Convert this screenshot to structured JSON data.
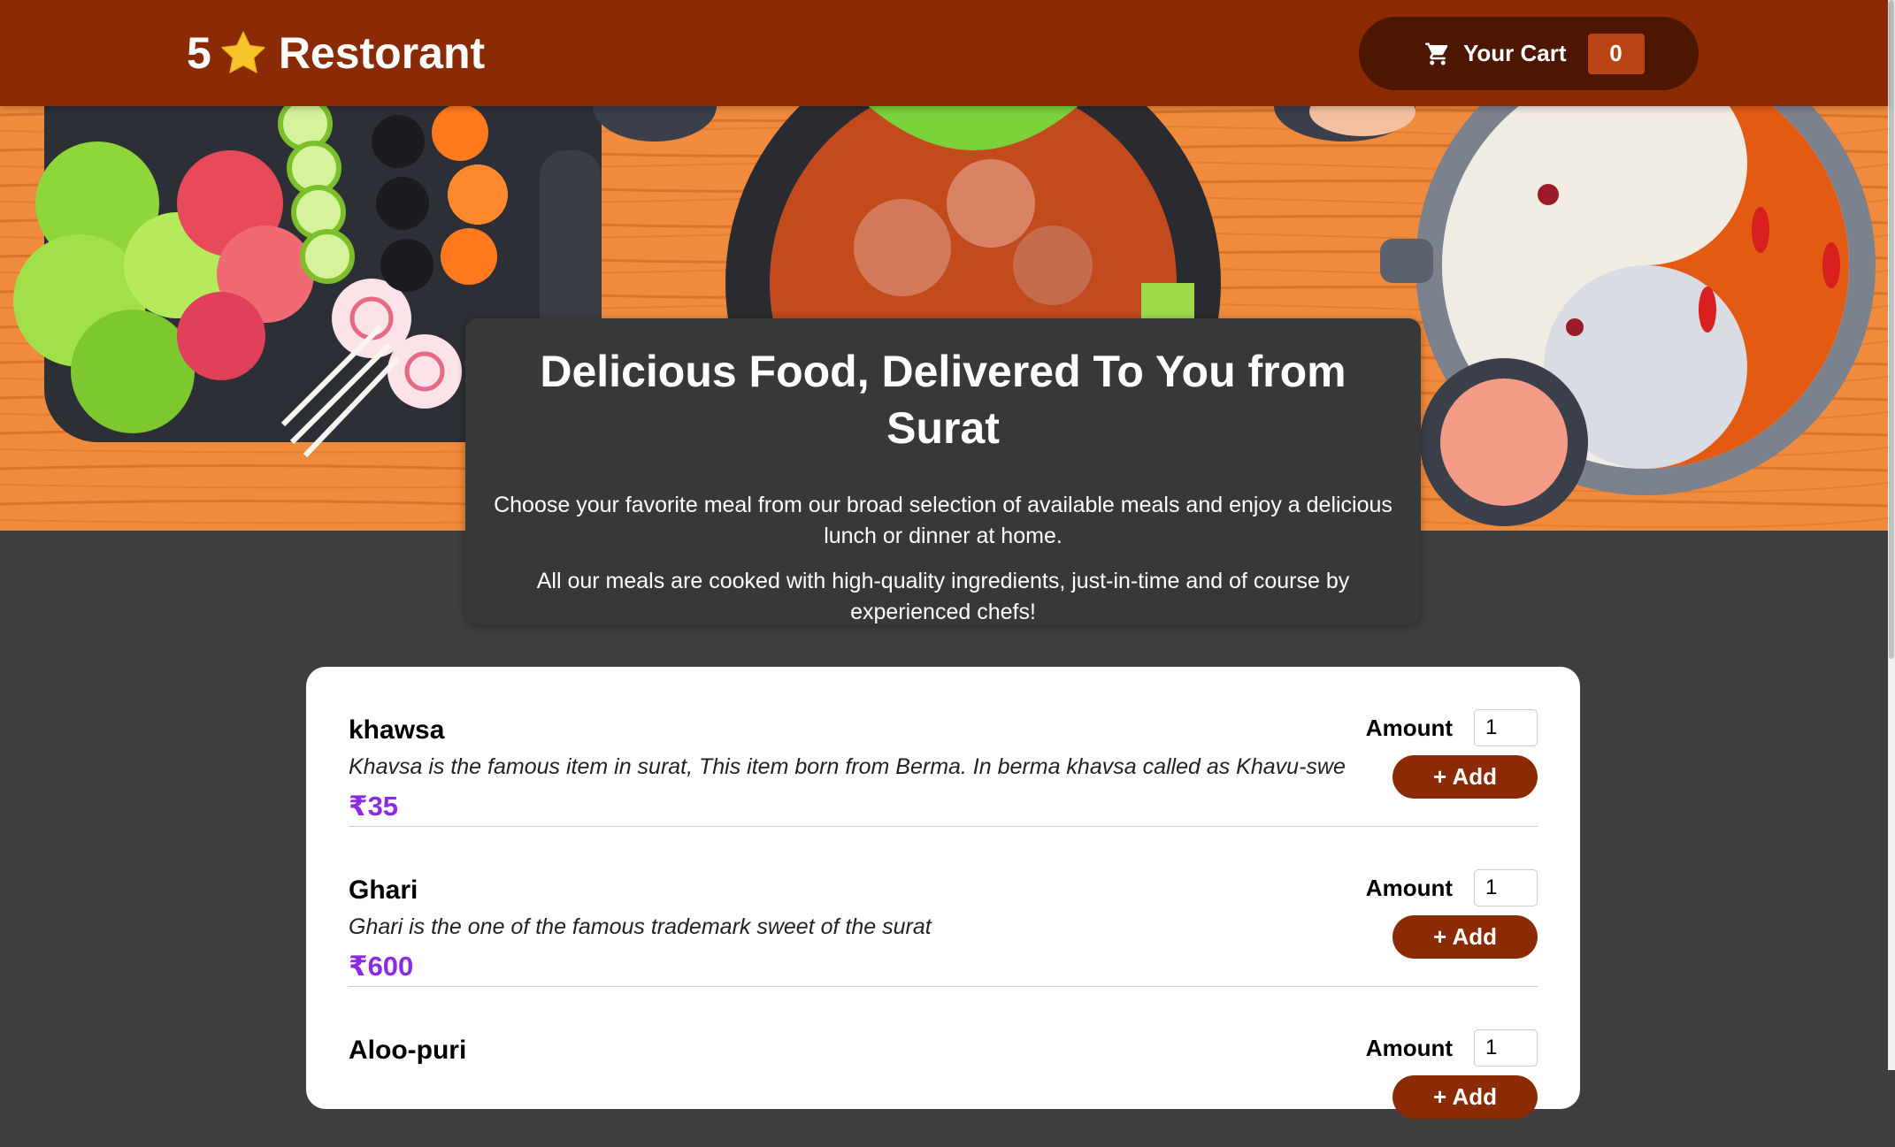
{
  "header": {
    "brand_number": "5",
    "brand_name": "Restorant",
    "cart_label": "Your Cart",
    "cart_count": "0"
  },
  "summary": {
    "title": "Delicious Food, Delivered To You from Surat",
    "paragraph_1": "Choose your favorite meal from our broad selection of available meals and enjoy a delicious lunch or dinner at home.",
    "paragraph_2": "All our meals are cooked with high-quality ingredients, just-in-time and of course by experienced chefs!"
  },
  "meals": [
    {
      "name": "khawsa",
      "description": "Khavsa is the famous item in surat, This item born from Berma. In berma khavsa called as Khavu-swe",
      "price": "₹35",
      "amount_label": "Amount",
      "amount_value": "1",
      "add_label": "+ Add"
    },
    {
      "name": "Ghari",
      "description": "Ghari is the one of the famous trademark sweet of the surat",
      "price": "₹600",
      "amount_label": "Amount",
      "amount_value": "1",
      "add_label": "+ Add"
    },
    {
      "name": "Aloo-puri",
      "description": "",
      "price": "",
      "amount_label": "Amount",
      "amount_value": "1",
      "add_label": "+ Add"
    }
  ],
  "colors": {
    "header_bg": "#8a2b06",
    "cart_bg": "#4d1601",
    "badge_bg": "#b94517",
    "page_bg": "#3f3f3f",
    "price": "#8a2be2",
    "star": "#f7c52b"
  },
  "icons": {
    "brand": "star-icon",
    "cart": "cart-icon"
  }
}
